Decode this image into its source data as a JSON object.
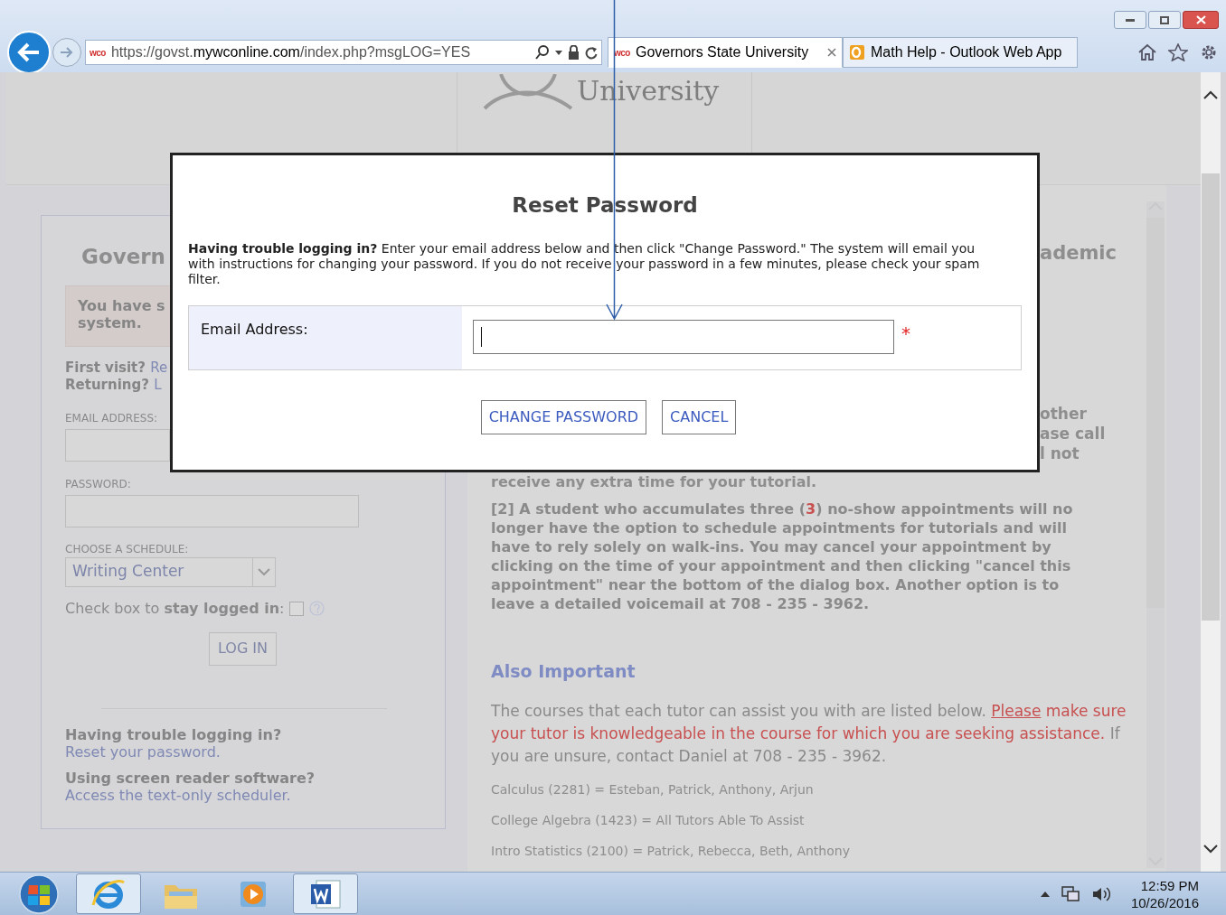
{
  "browser": {
    "address": {
      "favicon_text": "wco",
      "parts": [
        {
          "text": "https://govst.",
          "strong": false
        },
        {
          "text": "mywconline.com",
          "strong": true
        },
        {
          "text": "/index.php?msgLOG=YES",
          "strong": false
        }
      ]
    },
    "tabs": [
      {
        "kind": "wco",
        "favicon_text": "wco",
        "title": "Governors State University",
        "selected": true
      },
      {
        "kind": "outlook",
        "title": "Math Help - Outlook Web App",
        "selected": false
      }
    ]
  },
  "page": {
    "logo_text": "University",
    "login_panel": {
      "title": "Govern",
      "notice": [
        "You have s",
        "system."
      ],
      "visit_lines": [
        {
          "label": "First visit?",
          "link": "Re"
        },
        {
          "label": "Returning?",
          "link": "L"
        }
      ],
      "email_label": "EMAIL ADDRESS:",
      "password_label": "PASSWORD:",
      "schedule_label": "CHOOSE A SCHEDULE:",
      "schedule_value": "Writing Center",
      "stay_logged_in": {
        "text": "Check box to **stay logged in**:",
        "checked": false
      },
      "login_button": "LOG IN",
      "help": [
        {
          "label": "Having trouble logging in?",
          "link": "Reset your password."
        },
        {
          "label": "Using screen reader software?",
          "link": "Access the text-only scheduler."
        }
      ]
    },
    "info": {
      "heading_fragment": "ademic",
      "fragments": [
        "other",
        "ase call",
        "l not"
      ],
      "partial_line": "receive any extra time for your tutorial.",
      "rule_2": {
        "before": "[2]  A student who accumulates three (",
        "highlight": "3",
        "after": ") no-show appointments will no longer have the option to schedule appointments for tutorials and will have to rely solely on walk-ins.  You may cancel your appointment by clicking on the time of your appointment and then clicking \"cancel this appointment\" near the bottom of the dialog box.  Another option is to leave a detailed voicemail at  708 - 235 - 3962."
      },
      "also_heading": "Also Important",
      "courses_intro": {
        "before": "The courses that each tutor can assist you with are listed below. ",
        "link": "Please",
        "warning": " make sure your tutor is knowledgeable in the course for which you are seeking assistance.",
        "after": " If you are unsure, contact Daniel at 708 - 235 - 3962."
      },
      "courses": [
        "Calculus (2281) = Esteban, Patrick, Anthony, Arjun",
        "College Algebra (1423) = All Tutors Able To Assist",
        "Intro Statistics (2100) = Patrick, Rebecca, Beth, Anthony"
      ]
    }
  },
  "dialog": {
    "title": "Reset Password",
    "intro": "**Having trouble logging in?** Enter your email address below and then click \"Change Password.\" The system will email you with instructions for changing your password. If you do not receive your password in a few minutes, please check your spam filter.",
    "field_label": "Email Address:",
    "required_mark": "*",
    "buttons": [
      "CHANGE PASSWORD",
      "CANCEL"
    ]
  },
  "taskbar": {
    "apps": [
      {
        "kind": "ie",
        "active": true
      },
      {
        "kind": "explorer",
        "active": false
      },
      {
        "kind": "media",
        "active": false
      },
      {
        "kind": "word",
        "active": true
      }
    ],
    "time": "12:59 PM",
    "date": "10/26/2016"
  }
}
